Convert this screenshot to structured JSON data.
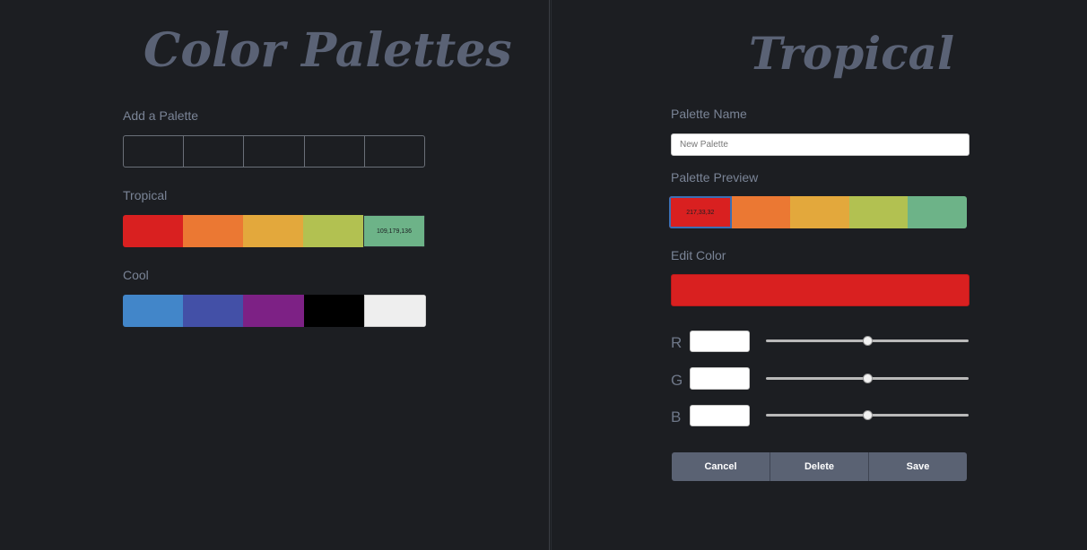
{
  "left_panel": {
    "title": "Color Palettes",
    "add_palette_label": "Add a Palette",
    "palettes": [
      {
        "name": "Tropical",
        "colors": [
          "#d92020",
          "#eb7833",
          "#e3a83c",
          "#b2c151",
          "#6db388"
        ],
        "hover_label": "109,179,136"
      },
      {
        "name": "Cool",
        "colors": [
          "#4286c9",
          "#4350a7",
          "#7d2185",
          "#000000",
          "#eeeeee"
        ]
      }
    ]
  },
  "editor": {
    "title": "Tropical",
    "palette_name_label": "Palette Name",
    "palette_name_placeholder": "New Palette",
    "palette_preview_label": "Palette Preview",
    "preview_colors": [
      "#d92020",
      "#eb7833",
      "#e3a83c",
      "#b2c151",
      "#6db388"
    ],
    "selected_swatch_label": "217,33,32",
    "edit_color_label": "Edit Color",
    "edit_color_value": "#d92020",
    "channels": [
      {
        "letter": "R",
        "value": "",
        "slider_fraction": 0.5
      },
      {
        "letter": "G",
        "value": "",
        "slider_fraction": 0.5
      },
      {
        "letter": "B",
        "value": "",
        "slider_fraction": 0.5
      }
    ],
    "buttons": {
      "cancel": "Cancel",
      "delete": "Delete",
      "save": "Save"
    }
  }
}
